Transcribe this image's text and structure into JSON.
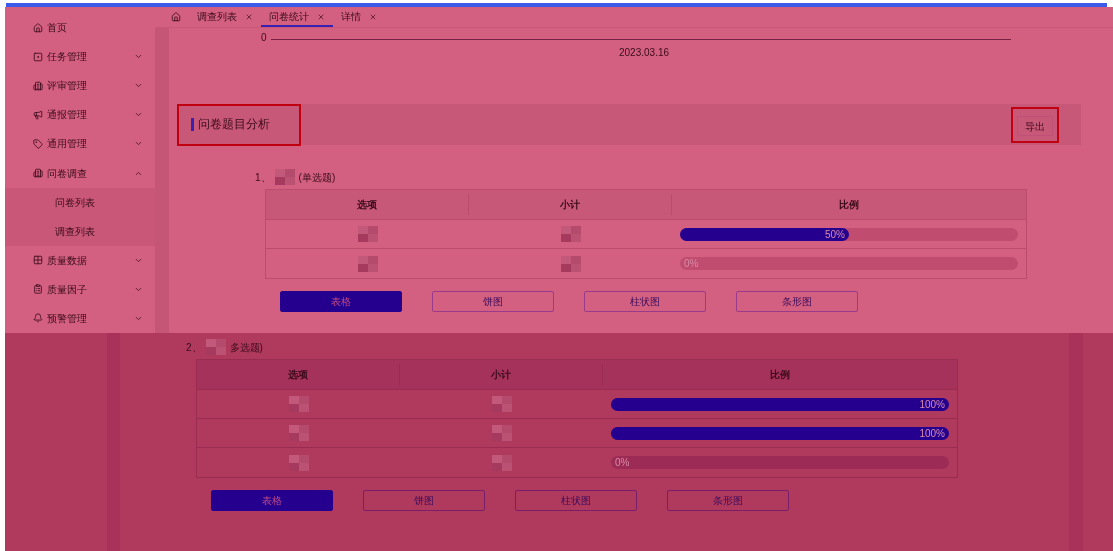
{
  "tabs": [
    {
      "kind": "home",
      "selected": false
    },
    {
      "label": "调查列表",
      "selected": false
    },
    {
      "label": "问卷统计",
      "selected": true
    },
    {
      "label": "详情",
      "selected": false
    }
  ],
  "sidebar": {
    "items": [
      {
        "label": "首页",
        "kind": "link"
      },
      {
        "label": "任务管理",
        "kind": "group",
        "expanded": false
      },
      {
        "label": "评审管理",
        "kind": "group",
        "expanded": false
      },
      {
        "label": "通报管理",
        "kind": "group",
        "expanded": false
      },
      {
        "label": "通用管理",
        "kind": "group",
        "expanded": false
      },
      {
        "label": "问卷调查",
        "kind": "group",
        "expanded": true,
        "children": [
          {
            "label": "问卷列表"
          },
          {
            "label": "调查列表"
          }
        ]
      },
      {
        "label": "质量数据",
        "kind": "group",
        "expanded": false
      },
      {
        "label": "质量因子",
        "kind": "group",
        "expanded": false
      },
      {
        "label": "预警管理",
        "kind": "group",
        "expanded": false
      }
    ]
  },
  "timeline": {
    "axis_label": "0",
    "date": "2023.03.16"
  },
  "section": {
    "title": "问卷题目分析",
    "title_highlighted": true,
    "export_button": "导出",
    "export_highlighted": true
  },
  "questions": [
    {
      "number": "1、",
      "type_label": "(单选题)",
      "columns": [
        "选项",
        "小计",
        "比例"
      ],
      "rows": [
        {
          "level": 0.5,
          "reading": "50%"
        },
        {
          "level": 0,
          "reading": "0%"
        }
      ],
      "view_buttons": [
        {
          "label": "表格",
          "selected": true
        },
        {
          "label": "饼图",
          "selected": false
        },
        {
          "label": "柱状图",
          "selected": false
        },
        {
          "label": "条形图",
          "selected": false
        }
      ]
    },
    {
      "number": "2、",
      "type_label": "多选题)",
      "columns": [
        "选项",
        "小计",
        "比例"
      ],
      "rows": [
        {
          "level": 1,
          "reading": "100%"
        },
        {
          "level": 1,
          "reading": "100%"
        },
        {
          "level": 0,
          "reading": "0%"
        }
      ],
      "view_buttons": [
        {
          "label": "表格",
          "selected": true
        },
        {
          "label": "饼图",
          "selected": false
        },
        {
          "label": "柱状图",
          "selected": false
        },
        {
          "label": "条形图",
          "selected": false
        }
      ]
    }
  ]
}
